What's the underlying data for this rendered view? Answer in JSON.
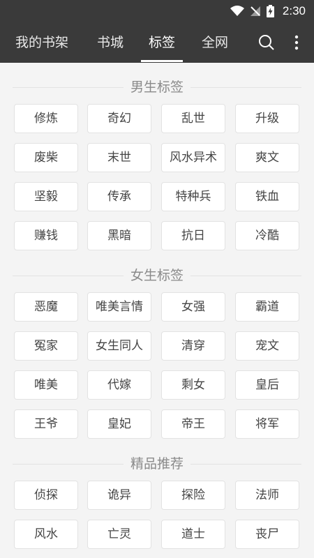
{
  "status_bar": {
    "time": "2:30"
  },
  "nav": {
    "tabs": [
      {
        "label": "我的书架"
      },
      {
        "label": "书城"
      },
      {
        "label": "标签",
        "active": true
      },
      {
        "label": "全网"
      }
    ],
    "icons": [
      "search-icon",
      "more-vert-icon"
    ]
  },
  "sections": [
    {
      "title": "男生标签",
      "tags": [
        "修炼",
        "奇幻",
        "乱世",
        "升级",
        "废柴",
        "末世",
        "风水异术",
        "爽文",
        "坚毅",
        "传承",
        "特种兵",
        "铁血",
        "赚钱",
        "黑暗",
        "抗日",
        "冷酷"
      ]
    },
    {
      "title": "女生标签",
      "tags": [
        "恶魔",
        "唯美言情",
        "女强",
        "霸道",
        "冤家",
        "女生同人",
        "清穿",
        "宠文",
        "唯美",
        "代嫁",
        "剩女",
        "皇后",
        "王爷",
        "皇妃",
        "帝王",
        "将军"
      ]
    },
    {
      "title": "精品推荐",
      "tags": [
        "侦探",
        "诡异",
        "探险",
        "法师",
        "风水",
        "亡灵",
        "道士",
        "丧尸"
      ]
    }
  ],
  "colors": {
    "bar": "#3a3a3a",
    "background": "#f4f4f4",
    "tag_text": "#444444",
    "section_title": "#8a8a8a"
  }
}
